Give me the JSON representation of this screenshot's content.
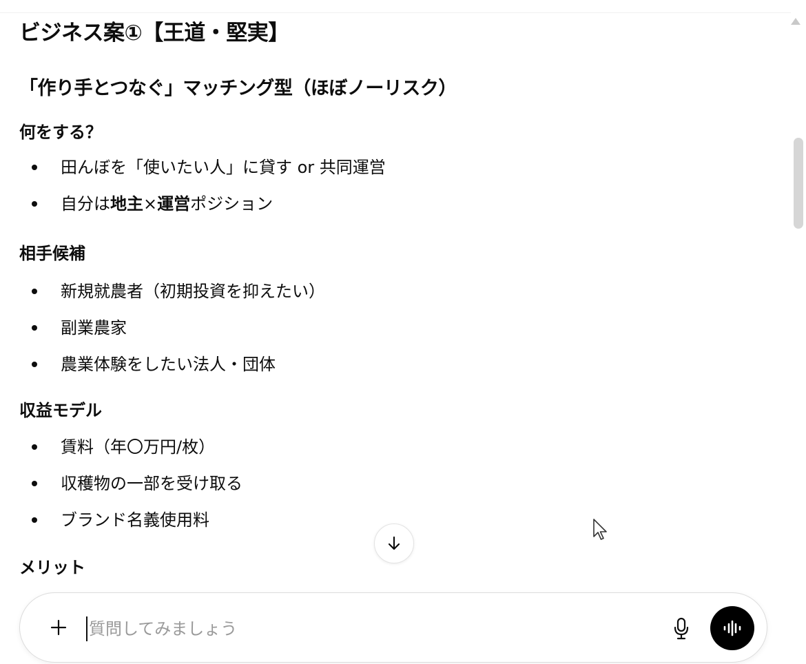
{
  "document": {
    "title": "ビジネス案①【王道・堅実】",
    "subtitle": "「作り手とつなぐ」マッチング型（ほぼノーリスク）",
    "sections": [
      {
        "heading": "何をする？",
        "items": [
          {
            "text": "田んぼを「使いたい人」に貸す or 共同運営"
          },
          {
            "pre": "自分は",
            "bold1": "地主",
            "mid": "×",
            "bold2": "運営",
            "post": "ポジション"
          }
        ]
      },
      {
        "heading": "相手候補",
        "items": [
          {
            "text": "新規就農者（初期投資を抑えたい）"
          },
          {
            "text": "副業農家"
          },
          {
            "text": "農業体験をしたい法人・団体"
          }
        ]
      },
      {
        "heading": "収益モデル",
        "items": [
          {
            "text": "賃料（年〇万円/枚）"
          },
          {
            "text": "収穫物の一部を受け取る"
          },
          {
            "text": "ブランド名義使用料"
          }
        ]
      },
      {
        "heading": "メリット",
        "items": []
      }
    ]
  },
  "composer": {
    "placeholder": "質問してみましょう",
    "value": ""
  },
  "icons": {
    "add": "plus-icon",
    "mic": "microphone-icon",
    "voice": "voice-mode-icon",
    "scroll_down": "arrow-down-icon",
    "cursor": "mouse-pointer-icon"
  },
  "colors": {
    "text": "#0d0d0d",
    "placeholder": "#9a9a9a",
    "voice_button": "#000000",
    "scrollbar": "#d6d6d6"
  }
}
